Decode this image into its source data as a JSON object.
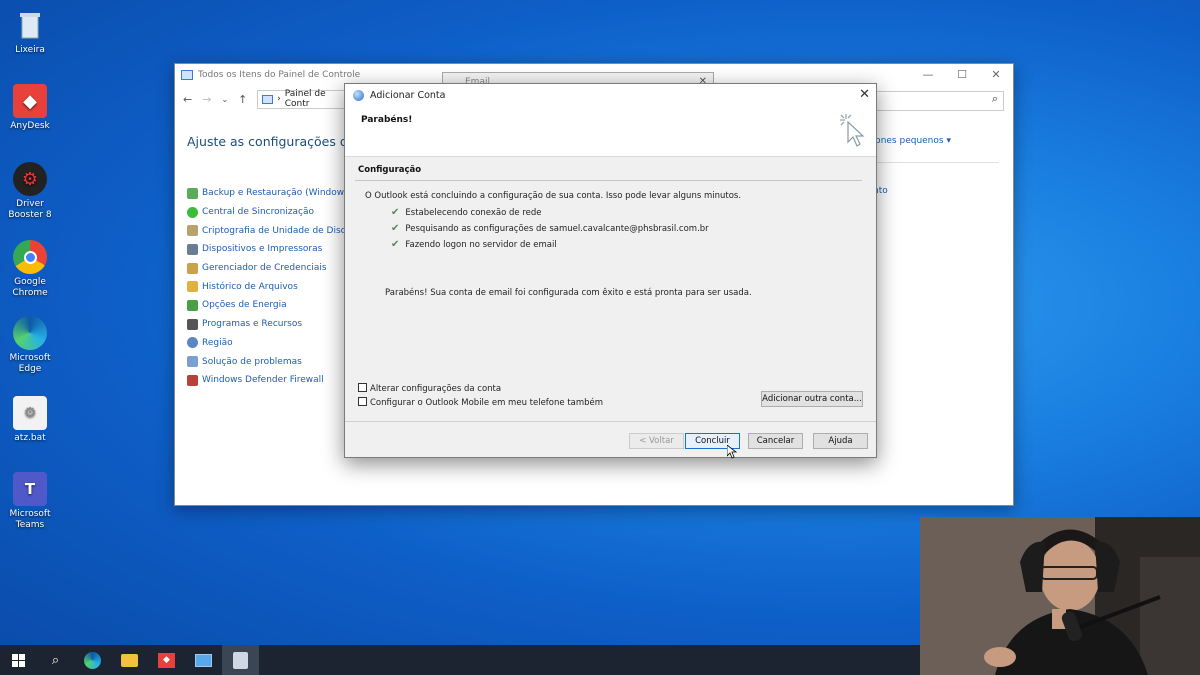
{
  "desktop_icons": [
    {
      "label": "Lixeira",
      "icon": "recycle-bin-icon"
    },
    {
      "label": "AnyDesk",
      "icon": "anydesk-icon"
    },
    {
      "label": "Driver Booster 8",
      "icon": "driver-booster-icon"
    },
    {
      "label": "Google Chrome",
      "icon": "chrome-icon"
    },
    {
      "label": "Microsoft Edge",
      "icon": "edge-icon"
    },
    {
      "label": "atz.bat",
      "icon": "bat-file-icon"
    },
    {
      "label": "Microsoft Teams",
      "icon": "teams-icon"
    }
  ],
  "control_panel": {
    "title": "Todos os Itens do Painel de Controle",
    "address": "Painel de Contr",
    "heading": "Ajuste as configurações do cor",
    "view_label": "cones pequenos",
    "right_fragment": "nto",
    "items": [
      "Backup e Restauração (Windows 7)",
      "Central de Sincronização",
      "Criptografia de Unidade de Disco Bit",
      "Dispositivos e Impressoras",
      "Gerenciador de Credenciais",
      "Histórico de Arquivos",
      "Opções de Energia",
      "Programas e Recursos",
      "Região",
      "Solução de problemas",
      "Windows Defender Firewall"
    ]
  },
  "email_window": {
    "title": "Email"
  },
  "dialog": {
    "title": "Adicionar Conta",
    "header": "Parabéns!",
    "section_title": "Configuração",
    "intro": "O Outlook está concluindo a configuração de sua conta. Isso pode levar alguns minutos.",
    "steps": [
      "Estabelecendo conexão de rede",
      "Pesquisando as configurações de samuel.cavalcante@phsbrasil.com.br",
      "Fazendo logon no servidor de email"
    ],
    "success": "Parabéns! Sua conta de email foi configurada com êxito e está pronta para ser usada.",
    "checkbox_change": "Alterar configurações da conta",
    "checkbox_mobile": "Configurar o Outlook Mobile em meu telefone também",
    "add_another": "Adicionar outra conta...",
    "back": "< Voltar",
    "finish": "Concluir",
    "cancel": "Cancelar",
    "help": "Ajuda"
  },
  "colors": {
    "accent": "#1a6fd0",
    "link": "#1a5fb4",
    "desktop": "#0e5fc8"
  }
}
